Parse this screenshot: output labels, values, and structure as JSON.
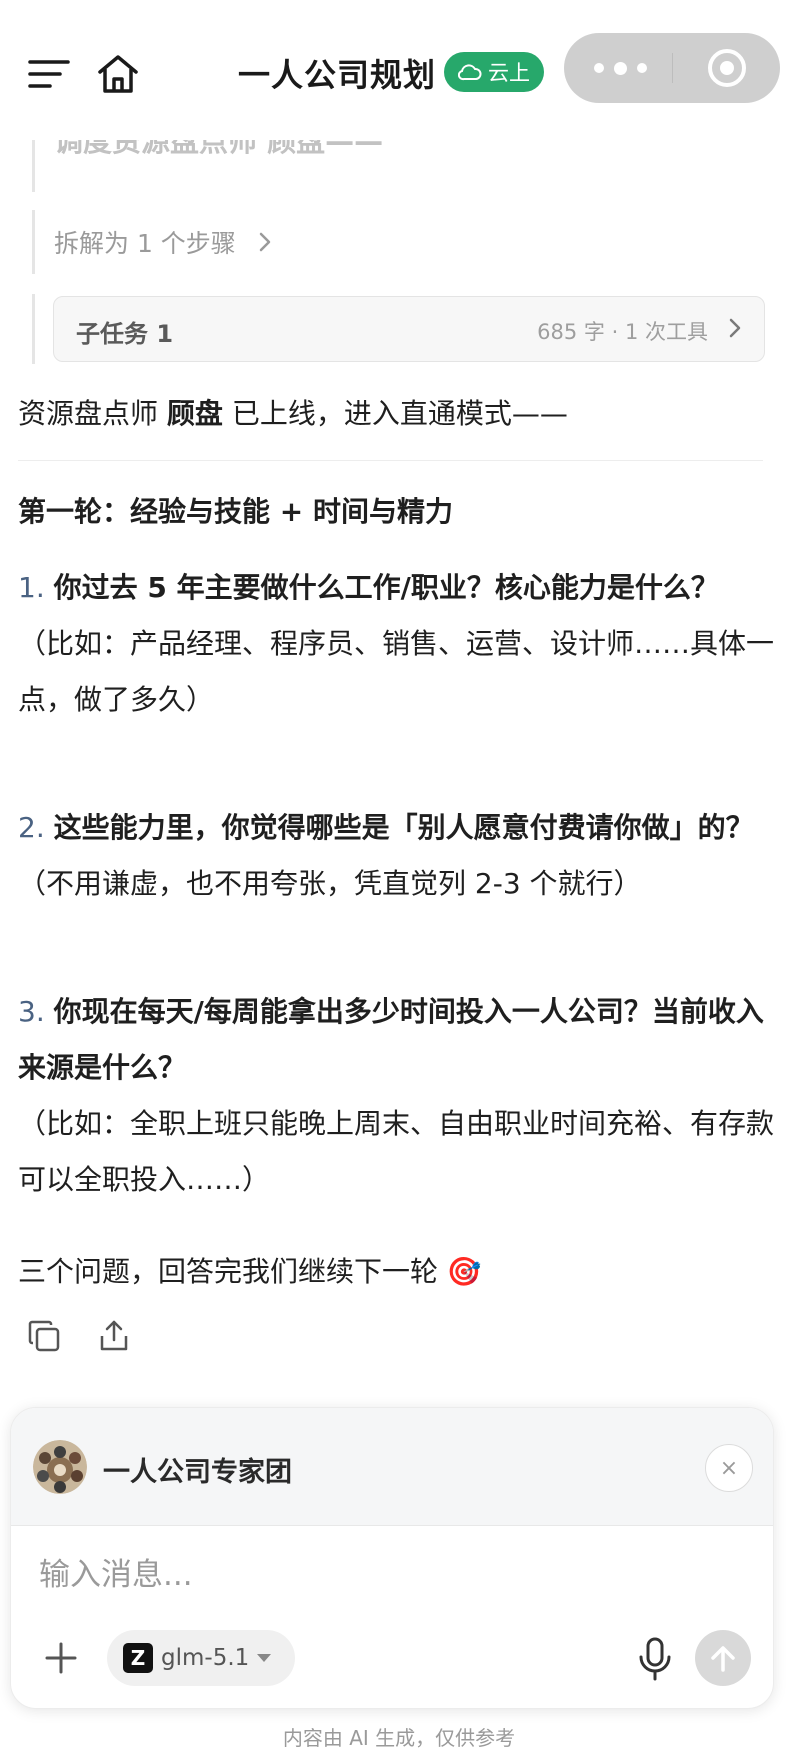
{
  "header": {
    "title": "一人公司规划",
    "cloud_badge": "云上"
  },
  "thread": {
    "faded_heading": "调度资源盘点师 顾盘——",
    "steps_label": "拆解为 1 个步骤",
    "subtask": {
      "label": "子任务 1",
      "meta": "685 字 · 1 次工具"
    }
  },
  "message": {
    "intro_prefix": "资源盘点师 ",
    "intro_name": "顾盘",
    "intro_suffix": " 已上线，进入直通模式——",
    "round_title": "第一轮：经验与技能 + 时间与精力",
    "questions": [
      {
        "num": "1.",
        "title": "你过去 5 年主要做什么工作/职业？核心能力是什么？",
        "hint": "（比如：产品经理、程序员、销售、运营、设计师……具体一点，做了多久）"
      },
      {
        "num": "2.",
        "title": "这些能力里，你觉得哪些是「别人愿意付费请你做」的？",
        "hint": "（不用谦虚，也不用夸张，凭直觉列 2-3 个就行）"
      },
      {
        "num": "3.",
        "title": "你现在每天/每周能拿出多少时间投入一人公司？当前收入来源是什么？",
        "hint": "（比如：全职上班只能晚上周末、自由职业时间充裕、有存款可以全职投入……）"
      }
    ],
    "closing": "三个问题，回答完我们继续下一轮 🎯"
  },
  "composer": {
    "agent_name": "一人公司专家团",
    "close_symbol": "×",
    "input_placeholder": "输入消息...",
    "model_logo": "Z",
    "model_name": "glm-5.1"
  },
  "footer": {
    "disclaimer": "内容由 AI 生成，仅供参考"
  }
}
